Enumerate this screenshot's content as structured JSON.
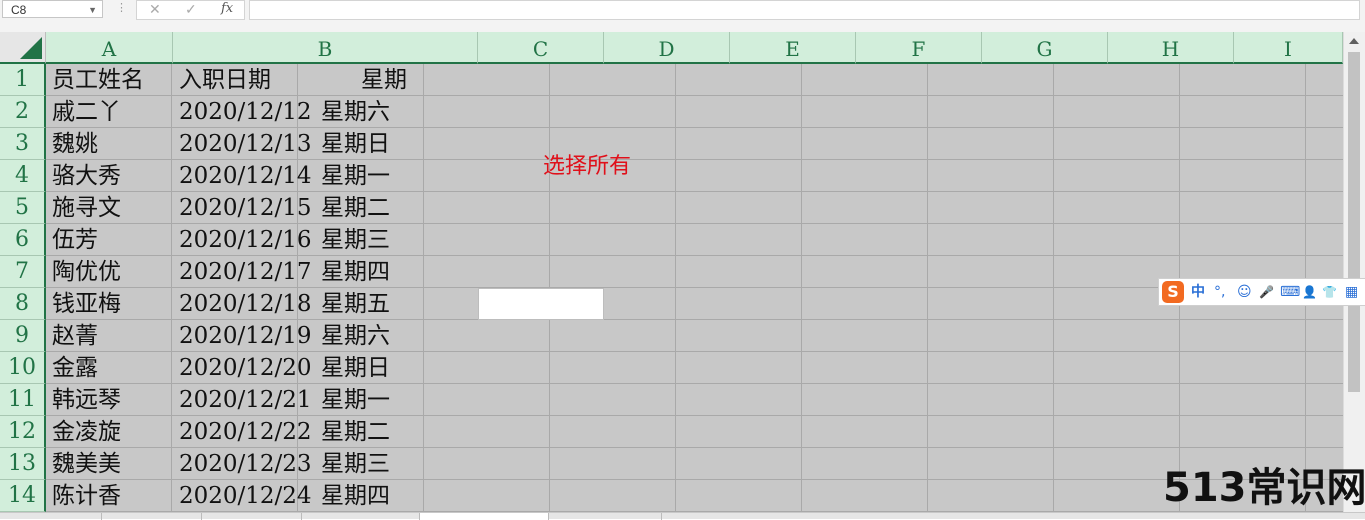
{
  "formula_bar": {
    "name_box": "C8",
    "cancel_icon": "✕",
    "enter_icon": "✓",
    "fx_label": "fx",
    "formula": ""
  },
  "columns": [
    "A",
    "B",
    "C",
    "D",
    "E",
    "F",
    "G",
    "H",
    "I"
  ],
  "rows": [
    "1",
    "2",
    "3",
    "4",
    "5",
    "6",
    "7",
    "8",
    "9",
    "10",
    "11",
    "12",
    "13",
    "14"
  ],
  "header_row": {
    "a": "员工姓名",
    "b": "入职日期",
    "b2": "星期"
  },
  "data_rows": [
    {
      "name": "戚二丫",
      "date": "2020/12/12",
      "weekday": "星期六"
    },
    {
      "name": "魏姚",
      "date": "2020/12/13",
      "weekday": "星期日"
    },
    {
      "name": "骆大秀",
      "date": "2020/12/14",
      "weekday": "星期一"
    },
    {
      "name": "施寻文",
      "date": "2020/12/15",
      "weekday": "星期二"
    },
    {
      "name": "伍芳",
      "date": "2020/12/16",
      "weekday": "星期三"
    },
    {
      "name": "陶优优",
      "date": "2020/12/17",
      "weekday": "星期四"
    },
    {
      "name": "钱亚梅",
      "date": "2020/12/18",
      "weekday": "星期五"
    },
    {
      "name": "赵菁",
      "date": "2020/12/19",
      "weekday": "星期六"
    },
    {
      "name": "金露",
      "date": "2020/12/20",
      "weekday": "星期日"
    },
    {
      "name": "韩远琴",
      "date": "2020/12/21",
      "weekday": "星期一"
    },
    {
      "name": "金凌旋",
      "date": "2020/12/22",
      "weekday": "星期二"
    },
    {
      "name": "魏美美",
      "date": "2020/12/23",
      "weekday": "星期三"
    },
    {
      "name": "陈计香",
      "date": "2020/12/24",
      "weekday": "星期四"
    }
  ],
  "annotation": "选择所有",
  "ime_toolbar": {
    "logo": "S",
    "items": [
      "中",
      "°,",
      "☺",
      "🎤",
      "⌨",
      "👤",
      "👕",
      "▦"
    ]
  },
  "watermark": "513常识网",
  "colors": {
    "accent": "#217346",
    "header_bg": "#d2eedb",
    "selection_bg": "#c8c8c8",
    "annotation": "#e0101a"
  }
}
